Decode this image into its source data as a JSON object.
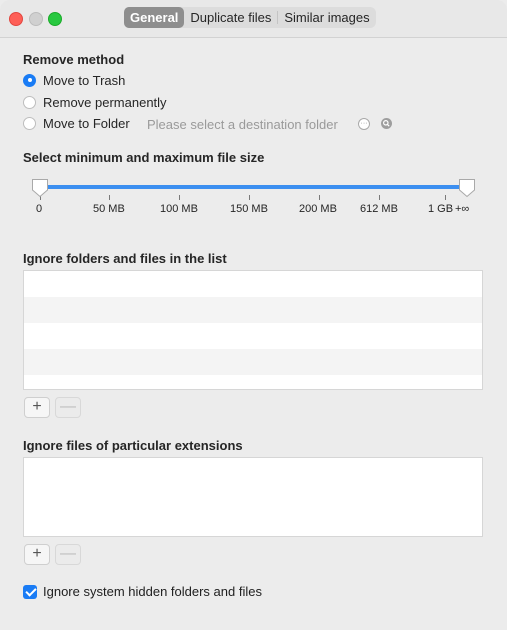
{
  "tabs": [
    {
      "label": "General"
    },
    {
      "label": "Duplicate files"
    },
    {
      "label": "Similar images"
    }
  ],
  "remove_method": {
    "title": "Remove method",
    "options": [
      {
        "label": "Move to Trash",
        "selected": true
      },
      {
        "label": "Remove permanently",
        "selected": false
      },
      {
        "label": "Move to Folder",
        "selected": false
      }
    ],
    "folder_placeholder": "Please select a destination folder"
  },
  "file_size": {
    "title": "Select minimum and maximum file size",
    "ticks": [
      "0",
      "50 MB",
      "100 MB",
      "150 MB",
      "200 MB",
      "612 MB",
      "1 GB",
      "+∞"
    ],
    "min": "0",
    "max": "+∞"
  },
  "ignore_folders": {
    "title": "Ignore folders and files in the list",
    "add_label": "+",
    "remove_label": "—"
  },
  "ignore_extensions": {
    "title": "Ignore files of particular extensions",
    "add_label": "+",
    "remove_label": "—"
  },
  "hidden_files": {
    "label": "Ignore system hidden folders and files",
    "checked": true
  },
  "colors": {
    "accent": "#1a7cf5",
    "slider": "#3c8ff0",
    "close": "#fe5f57",
    "maximize": "#28c840"
  }
}
